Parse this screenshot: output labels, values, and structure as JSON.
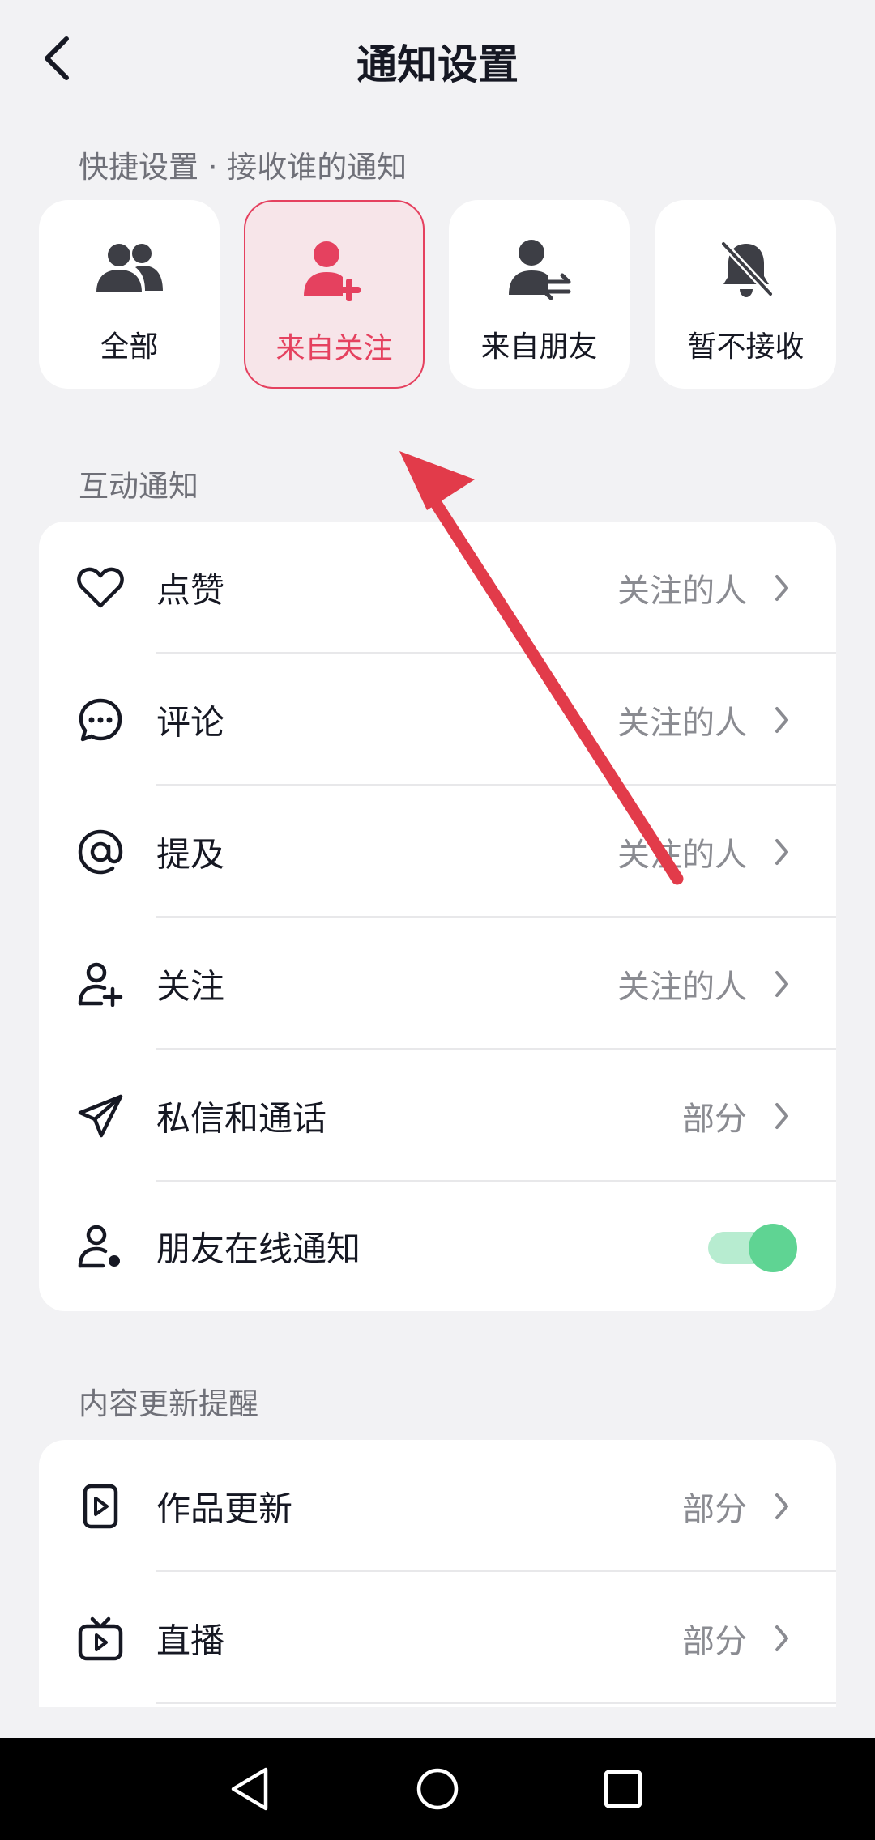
{
  "header": {
    "title": "通知设置"
  },
  "quick": {
    "section_label": "快捷设置 · 接收谁的通知",
    "options": [
      {
        "label": "全部",
        "icon": "people-icon"
      },
      {
        "label": "来自关注",
        "icon": "person-add-icon",
        "selected": true
      },
      {
        "label": "来自朋友",
        "icon": "person-swap-icon"
      },
      {
        "label": "暂不接收",
        "icon": "bell-off-icon"
      }
    ]
  },
  "interaction": {
    "section_label": "互动通知",
    "rows": [
      {
        "label": "点赞",
        "value": "关注的人",
        "icon": "heart-icon"
      },
      {
        "label": "评论",
        "value": "关注的人",
        "icon": "comment-icon"
      },
      {
        "label": "提及",
        "value": "关注的人",
        "icon": "at-icon"
      },
      {
        "label": "关注",
        "value": "关注的人",
        "icon": "follow-icon"
      },
      {
        "label": "私信和通话",
        "value": "部分",
        "icon": "send-icon"
      },
      {
        "label": "朋友在线通知",
        "icon": "person-online-icon",
        "toggle_on": true
      }
    ]
  },
  "content": {
    "section_label": "内容更新提醒",
    "rows": [
      {
        "label": "作品更新",
        "value": "部分",
        "icon": "video-icon"
      },
      {
        "label": "直播",
        "value": "部分",
        "icon": "tv-icon"
      }
    ]
  },
  "colors": {
    "accent": "#e5415f",
    "toggle_on": "#5fd493",
    "annotation": "#e23b4a"
  }
}
